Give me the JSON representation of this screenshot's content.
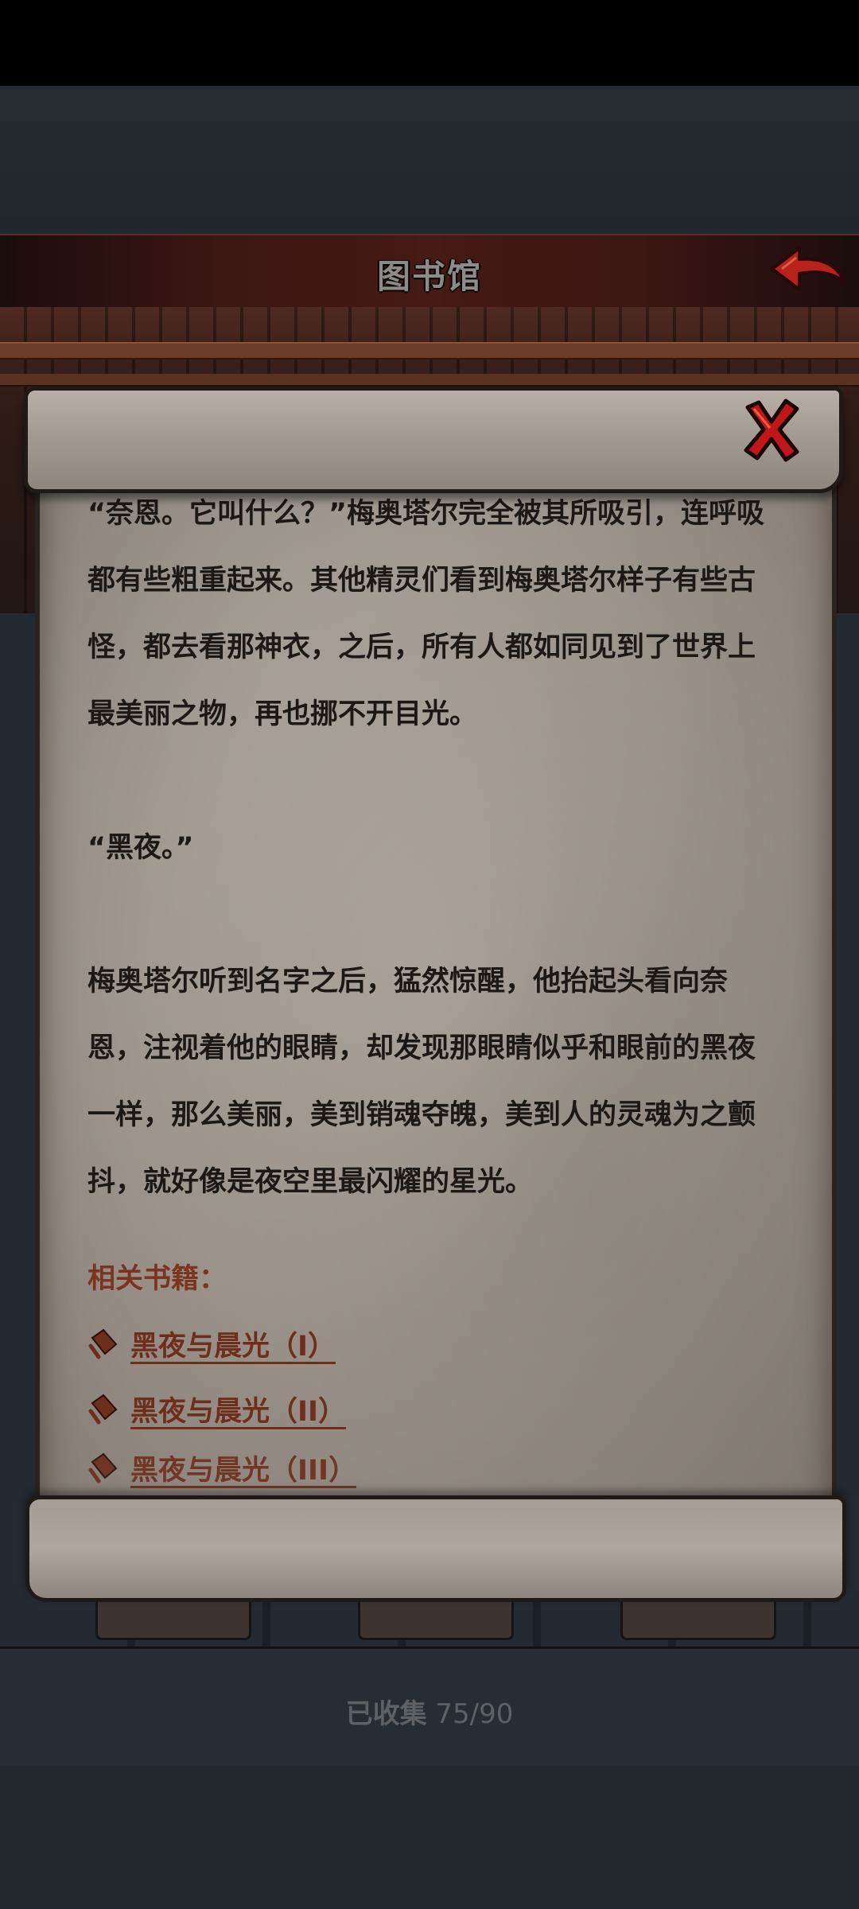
{
  "header": {
    "title": "图书馆"
  },
  "story": {
    "paragraphs": [
      "“奈恩。它叫什么？”梅奥塔尔完全被其所吸引，连呼吸都有些粗重起来。其他精灵们看到梅奥塔尔样子有些古怪，都去看那神衣，之后，所有人都如同见到了世界上最美丽之物，再也挪不开目光。",
      "“黑夜。”",
      "梅奥塔尔听到名字之后，猛然惊醒，他抬起头看向奈恩，注视着他的眼睛，却发现那眼睛似乎和眼前的黑夜一样，那么美丽，美到销魂夺魄，美到人的灵魂为之颤抖，就好像是夜空里最闪耀的星光。"
    ],
    "related_title": "相关书籍：",
    "related_books": [
      "黑夜与晨光（I）",
      "黑夜与晨光（II）",
      "黑夜与晨光（III）"
    ]
  },
  "footer": {
    "collected_label": "已收集",
    "collected_value": "75/90"
  },
  "icons": {
    "back": "back-arrow-icon",
    "close": "close-x-icon",
    "book": "book-icon"
  },
  "colors": {
    "header_red": "#461a15",
    "link_brown": "#6e2e1c",
    "close_red": "#c01818",
    "parchment": "#a39b92"
  }
}
